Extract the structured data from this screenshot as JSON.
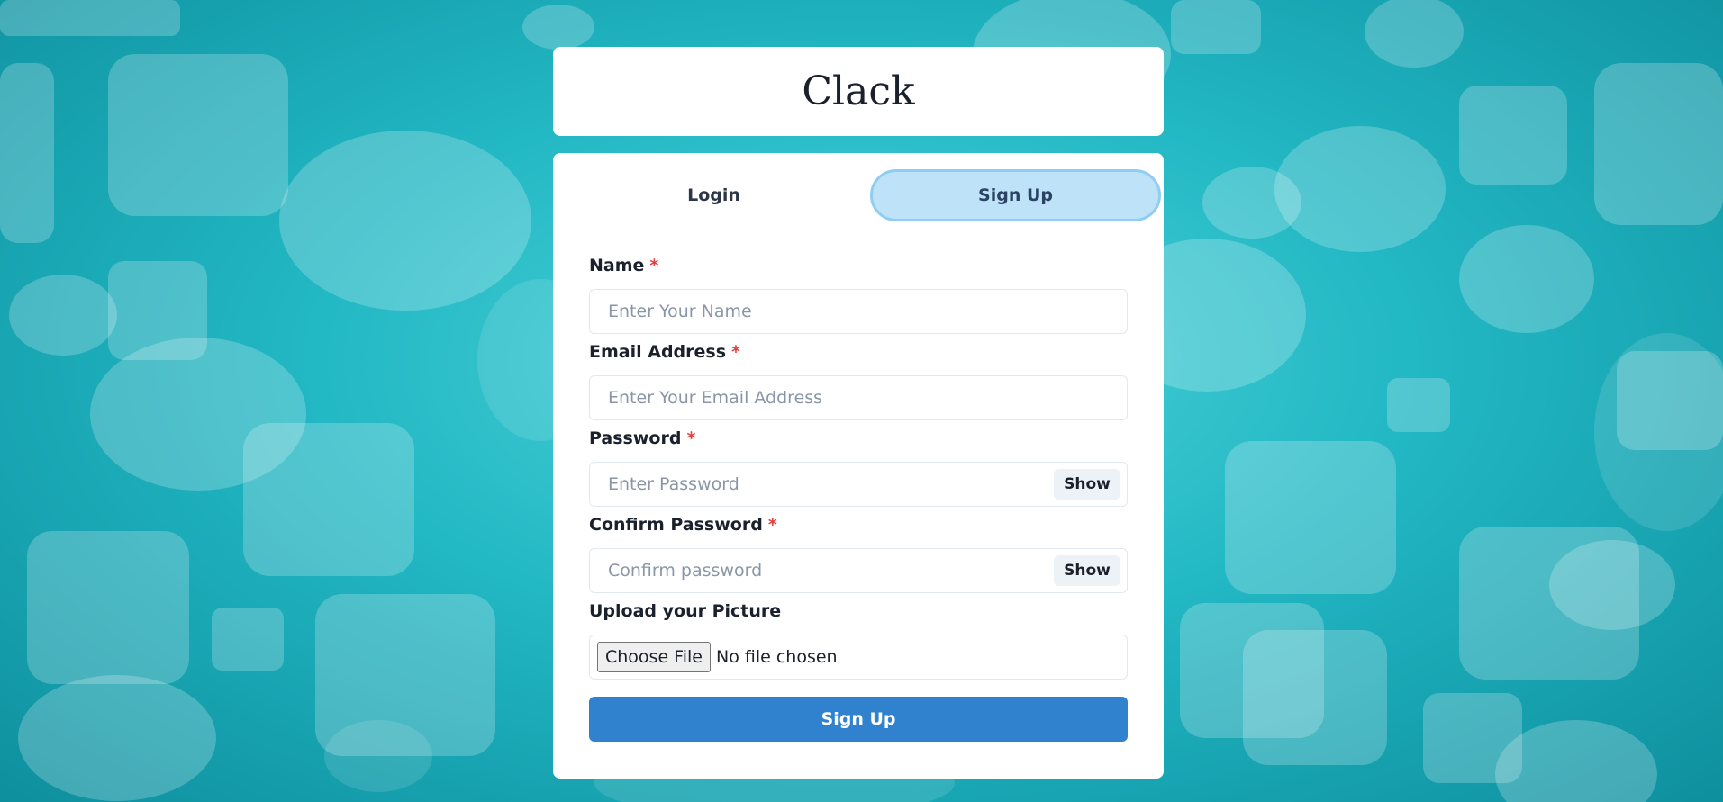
{
  "app": {
    "title": "Clack"
  },
  "tabs": [
    {
      "label": "Login",
      "active": false
    },
    {
      "label": "Sign Up",
      "active": true
    }
  ],
  "form": {
    "name": {
      "label": "Name",
      "required_mark": "*",
      "placeholder": "Enter Your Name",
      "value": ""
    },
    "email": {
      "label": "Email Address",
      "required_mark": "*",
      "placeholder": "Enter Your Email Address",
      "value": ""
    },
    "password": {
      "label": "Password",
      "required_mark": "*",
      "placeholder": "Enter Password",
      "value": "",
      "toggle_label": "Show"
    },
    "confirm_password": {
      "label": "Confirm Password",
      "required_mark": "*",
      "placeholder": "Confirm password",
      "value": "",
      "toggle_label": "Show"
    },
    "picture": {
      "label": "Upload your Picture",
      "button_label": "Choose File",
      "status": "No file chosen"
    },
    "submit_label": "Sign Up"
  },
  "colors": {
    "background_accent": "#22b8c4",
    "active_tab": "#bee3f8",
    "submit_button": "#3182ce",
    "required_mark": "#e53e3e"
  }
}
